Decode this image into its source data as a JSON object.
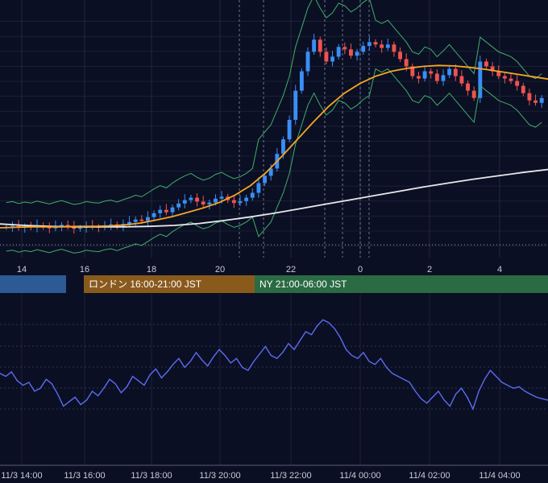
{
  "colors": {
    "background": "#0b0f24",
    "grid": "#3a4158",
    "up_candle": "#3a8ef6",
    "down_candle": "#ef5350",
    "ma_orange": "#f5a623",
    "ma_white": "#e8e8e8",
    "bollinger": "#3fae6a",
    "oscillator": "#5b6cf0"
  },
  "sessions": [
    {
      "label": "",
      "color": "#2b5a94"
    },
    {
      "label": "ロンドン 16:00-21:00 JST",
      "color": "#8a5a1c"
    },
    {
      "label": "NY 21:00-06:00 JST",
      "color": "#2a6b43"
    }
  ],
  "chart_data": [
    {
      "type": "candlestick",
      "x_tick_labels": [
        "14",
        "16",
        "18",
        "20",
        "22",
        "0",
        "2",
        "4"
      ],
      "series": [
        {
          "kind": "close",
          "values": [
            40.0,
            40.2,
            39.8,
            40.1,
            39.9,
            40.3,
            40.0,
            39.7,
            40.1,
            40.4,
            40.0,
            39.6,
            39.8,
            40.2,
            40.0,
            39.9,
            40.3,
            40.5,
            40.1,
            40.6,
            41.0,
            41.5,
            41.2,
            42.0,
            42.8,
            43.5,
            43.0,
            44.0,
            44.8,
            45.5,
            46.0,
            45.2,
            44.6,
            45.0,
            45.8,
            46.2,
            45.5,
            44.9,
            45.3,
            46.0,
            47.0,
            49.0,
            50.5,
            52.0,
            55.0,
            58.0,
            62.0,
            68.0,
            72.0,
            76.0,
            78.5,
            76.0,
            74.0,
            75.0,
            77.0,
            76.5,
            75.2,
            76.0,
            77.2,
            78.0,
            77.5,
            76.8,
            77.5,
            76.0,
            74.5,
            73.0,
            71.0,
            70.5,
            72.0,
            71.5,
            70.0,
            71.2,
            72.5,
            71.0,
            69.5,
            68.0,
            66.5,
            74.0,
            73.0,
            72.0,
            71.0,
            70.5,
            70.0,
            69.0,
            67.5,
            66.0,
            65.5,
            66.5
          ]
        },
        {
          "kind": "moving_average_short",
          "values": [
            39.8,
            39.9,
            40.0,
            40.0,
            40.0,
            40.1,
            40.1,
            40.2,
            40.4,
            40.8,
            41.4,
            42.1,
            43.0,
            43.9,
            45.0,
            46.5,
            48.5,
            51.2,
            54.5,
            58.0,
            61.5,
            64.8,
            67.5,
            69.5,
            71.0,
            72.0,
            72.6,
            73.0,
            73.2,
            73.1,
            72.8,
            72.4,
            71.9,
            71.4,
            70.9,
            70.4
          ]
        },
        {
          "kind": "moving_average_long",
          "values": [
            40.6,
            40.3,
            40.1,
            40.0,
            40.0,
            40.0,
            40.1,
            40.3,
            40.7,
            41.3,
            42.0,
            42.8,
            43.7,
            44.6,
            45.5,
            46.4,
            47.3,
            48.2,
            49.0,
            49.8,
            50.5,
            51.2,
            51.8
          ]
        }
      ],
      "grid": true
    },
    {
      "type": "line",
      "x_tick_labels": [
        "11/3 14:00",
        "11/3 16:00",
        "11/3 18:00",
        "11/3 20:00",
        "11/3 22:00",
        "11/4 00:00",
        "11/4 02:00",
        "11/4 04:00"
      ],
      "series": [
        {
          "values": [
            52,
            50,
            53,
            47,
            44,
            46,
            40,
            42,
            48,
            45,
            38,
            30,
            33,
            36,
            31,
            34,
            40,
            37,
            42,
            48,
            45,
            39,
            43,
            50,
            47,
            44,
            51,
            55,
            49,
            53,
            58,
            62,
            56,
            60,
            66,
            61,
            57,
            63,
            68,
            64,
            59,
            62,
            56,
            54,
            60,
            65,
            70,
            64,
            62,
            66,
            72,
            68,
            74,
            80,
            78,
            84,
            88,
            86,
            82,
            76,
            68,
            64,
            62,
            66,
            60,
            58,
            62,
            56,
            52,
            50,
            48,
            46,
            40,
            35,
            32,
            36,
            40,
            34,
            30,
            38,
            42,
            36,
            28,
            40,
            48,
            54,
            50,
            46,
            44,
            42,
            43,
            40,
            38,
            36,
            35,
            34
          ]
        }
      ],
      "grid": true
    }
  ]
}
